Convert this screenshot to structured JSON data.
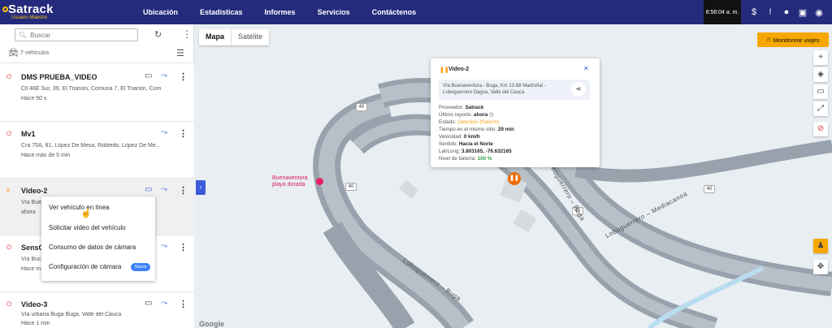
{
  "brand": {
    "name": "Satrack",
    "subtitle": "Usuario Maestro"
  },
  "nav": [
    "Ubicación",
    "Estadísticas",
    "Informes",
    "Servicios",
    "Contáctenos"
  ],
  "clock": "8:58:04 a. m.",
  "top_icons": [
    "dollar-icon",
    "alert-icon",
    "bell-icon",
    "gallery-icon",
    "user-icon"
  ],
  "sidebar": {
    "search_placeholder": "Buscar",
    "vehicle_count": "7 vehículos",
    "vehicles": [
      {
        "name": "DMS PRUEBA_VIDEO",
        "address": "Cll 46E Sur, 39, El Trianón, Comuna 7, El Trianón, Com...",
        "time": "Hace 50 s",
        "status": "power"
      },
      {
        "name": "Mv1",
        "address": "Cra 75A, 81, López De Mesa, Robledo, López De Me...",
        "time": "Hace más de 5 min",
        "status": "power"
      },
      {
        "name": "Video-2",
        "address": "Vía Buen",
        "time": "ahora",
        "status": "pause"
      },
      {
        "name": "SensC",
        "address": "Vía Buc",
        "time": "Hace m",
        "status": "power"
      },
      {
        "name": "Video-3",
        "address": "Vía urbana Buga Buga, Valle del Cauca",
        "time": "Hace 1 min",
        "status": "power"
      }
    ]
  },
  "context_menu": {
    "items": [
      "Ver vehículo en línea",
      "Solicitar video del vehículo",
      "Consumo de datos de cámara",
      "Configuración de cámara"
    ],
    "badge": "Nuevo"
  },
  "map": {
    "tabs": [
      "Mapa",
      "Satélite"
    ],
    "monitor_button": "Monitorear viajes",
    "poi": "Buenaventura playa dorada",
    "route_shields": [
      "40",
      "40",
      "40",
      "40"
    ],
    "road_labels": [
      "Loboguerrero – Buga",
      "Loboguerrero – Mediacanoa",
      "Loboguerrero – Buga"
    ],
    "google": "Google"
  },
  "popup": {
    "title": "Video-2",
    "address": "Vía Buenaventura - Buga, Km 13.68 Madroñal - Loboguerrero Dagua, Valle del Cauca",
    "rows": [
      {
        "label": "Proveedor: ",
        "value": "Satrack"
      },
      {
        "label": "Último reporte: ",
        "value": "ahora"
      },
      {
        "label": "Estado: ",
        "value": "Detenido (Ralentí)"
      },
      {
        "label": "Tiempo en el mismo sitio: ",
        "value": "29 min"
      },
      {
        "label": "Velocidad: ",
        "value": "0 km/h"
      },
      {
        "label": "Sentido: ",
        "value": "Hacia el Norte"
      },
      {
        "label": "Lat/Long: ",
        "value": "3.803165, -76.632165"
      },
      {
        "label": "Nivel de batería: ",
        "value": "100 %"
      }
    ]
  },
  "colors": {
    "nav_bg": "#242b7c",
    "accent": "#3b5bdb",
    "warning": "#f6a800",
    "status_stopped": "#f5a623",
    "battery_ok": "#2e9e44"
  }
}
